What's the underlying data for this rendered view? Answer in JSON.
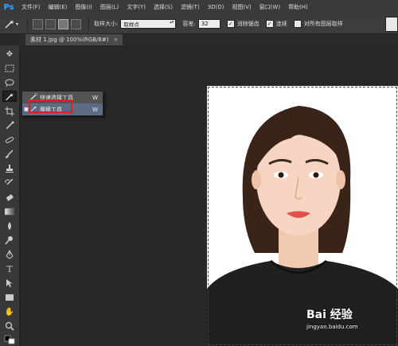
{
  "app": {
    "logo": "Ps"
  },
  "menu": [
    "文件(F)",
    "编辑(E)",
    "图像(I)",
    "图层(L)",
    "文字(Y)",
    "选择(S)",
    "滤镜(T)",
    "3D(D)",
    "视图(V)",
    "窗口(W)",
    "帮助(H)"
  ],
  "options": {
    "sample_size_label": "取样大小:",
    "sample_size_value": "取样点",
    "tolerance_label": "容差:",
    "tolerance_value": "32",
    "antialias_label": "消除锯齿",
    "antialias_checked": true,
    "contiguous_label": "连续",
    "contiguous_checked": true,
    "all_layers_label": "对所有图层取样",
    "all_layers_checked": false,
    "check_mark": "✓"
  },
  "document": {
    "tab_title": "素材 1.jpg @ 100%(RGB/8#)",
    "close_glyph": "×"
  },
  "flyout": {
    "items": [
      {
        "label": "快速选择工具",
        "shortcut": "W",
        "bullet": "",
        "icon": "quick-selection-icon"
      },
      {
        "label": "魔棒工具",
        "shortcut": "W",
        "bullet": "■",
        "icon": "magic-wand-icon"
      }
    ]
  },
  "watermark": {
    "logo": "Bai 经验",
    "url": "jingyan.baidu.com"
  },
  "colors": {
    "accent": "#31a8ff",
    "highlight_border": "#e02020",
    "selected_row": "#5c6c85"
  }
}
